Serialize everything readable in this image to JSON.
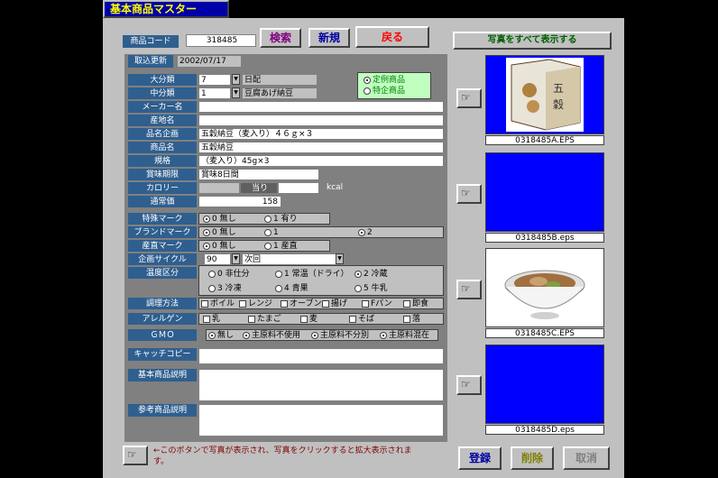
{
  "window": {
    "title": "基本商品マスター"
  },
  "toolbar": {
    "code_label": "商品コード",
    "code_value": "318485",
    "search": "検索",
    "new": "新規",
    "back": "戻る",
    "show_all_photos": "写真をすべて表示する"
  },
  "updated": {
    "label": "取込更新",
    "value": "2002/07/17"
  },
  "form": {
    "daibunrui": {
      "label": "大分類",
      "code": "7",
      "name": "日配"
    },
    "chubunrui": {
      "label": "中分類",
      "code": "1",
      "name": "豆腐あげ納豆"
    },
    "maker": {
      "label": "メーカー名",
      "value": ""
    },
    "origin": {
      "label": "産地名",
      "value": ""
    },
    "kikaku_name": {
      "label": "品名企画",
      "value": "五穀納豆（麦入り）４６ｇ×３"
    },
    "product_name": {
      "label": "商品名",
      "value": "五穀納豆"
    },
    "spec": {
      "label": "規格",
      "value": "（麦入り）45g×3"
    },
    "expiry": {
      "label": "賞味期限",
      "value": "賞味8日間"
    },
    "calorie": {
      "label": "カロリー",
      "per": "当り",
      "unit": "kcal"
    },
    "price": {
      "label": "通常価",
      "value": "158"
    },
    "special_mark": {
      "label": "特殊マーク",
      "options": [
        "0 無し",
        "1 有り"
      ]
    },
    "brand_mark": {
      "label": "ブランドマーク",
      "options": [
        "0 無し",
        "1",
        "2"
      ]
    },
    "origin_mark": {
      "label": "産直マーク",
      "options": [
        "0 無し",
        "1 産直"
      ]
    },
    "cycle": {
      "label": "企画サイクル",
      "code": "90",
      "name": "次回"
    },
    "temp": {
      "label": "温度区分",
      "options": [
        "0 非仕分",
        "1 常温（ドライ）",
        "2 冷蔵",
        "3 冷凍",
        "4 青果",
        "5 牛乳"
      ]
    },
    "cooking": {
      "label": "調理方法",
      "options": [
        "ボイル",
        "レンジ",
        "オーブン",
        "揚げ",
        "Fパン",
        "即食"
      ]
    },
    "allergen": {
      "label": "アレルゲン",
      "options": [
        "乳",
        "たまご",
        "麦",
        "そば",
        "落"
      ]
    },
    "gmo": {
      "label": "ＧＭＯ",
      "options": [
        "無し",
        "主原料不使用",
        "主原料不分別",
        "主原料混在"
      ]
    },
    "catchcopy": {
      "label": "キャッチコピー",
      "value": ""
    },
    "basic_desc": {
      "label": "基本商品説明",
      "value": ""
    },
    "ref_desc": {
      "label": "参考商品説明",
      "value": ""
    }
  },
  "product_type": {
    "options": [
      "定例商品",
      "特企商品"
    ]
  },
  "photos": [
    {
      "caption": "0318485A.EPS"
    },
    {
      "caption": "0318485B.eps"
    },
    {
      "caption": "0318485C.EPS"
    },
    {
      "caption": "0318485D.eps"
    }
  ],
  "footer": {
    "hint": "←このボタンで写真が表示され、写真をクリックすると拡大表示されます。",
    "register": "登録",
    "delete": "削除",
    "cancel": "取消"
  }
}
